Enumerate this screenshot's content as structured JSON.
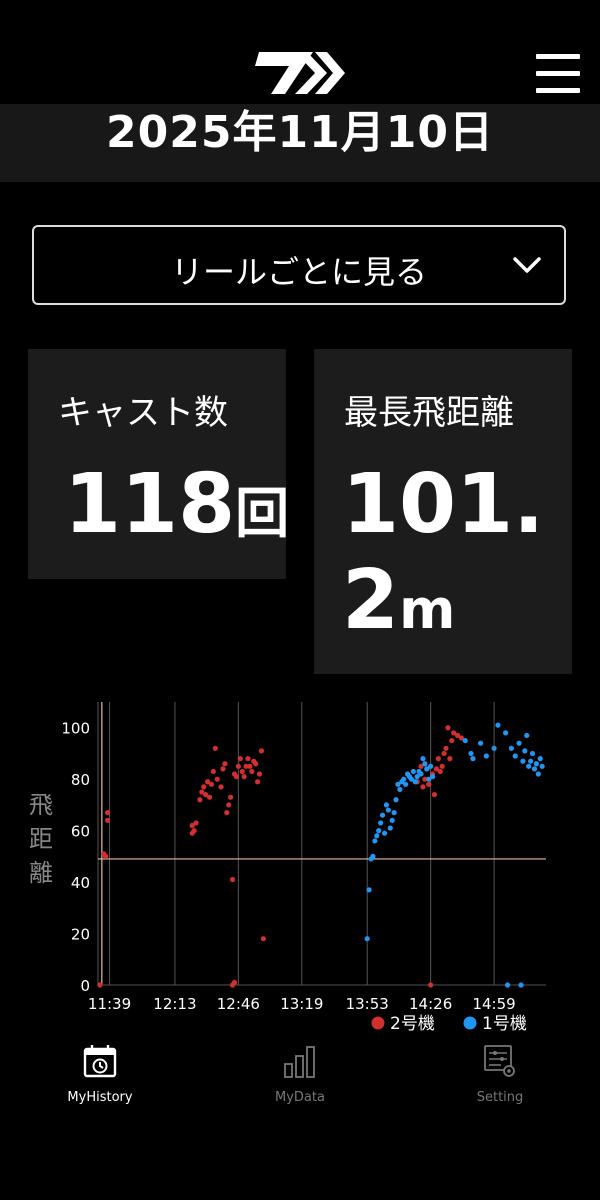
{
  "header": {
    "logo_icon": "daiwa-d-logo-icon",
    "menu_icon": "hamburger-menu-icon",
    "date": "2025年11月10日"
  },
  "view_select": {
    "label": "リールごとに見る",
    "icon": "chevron-down-icon"
  },
  "stats": {
    "cast_count": {
      "title": "キャスト数",
      "value": "118",
      "unit": "回"
    },
    "max_distance": {
      "title": "最長飛距離",
      "value": "101.2",
      "unit": "m"
    }
  },
  "chart_data": {
    "type": "scatter",
    "ylabel": "飛距離",
    "ylim": [
      0,
      110
    ],
    "yticks": [
      0,
      20,
      40,
      60,
      80,
      100
    ],
    "xticks": [
      "11:39",
      "12:13",
      "12:46",
      "13:19",
      "13:53",
      "14:26",
      "14:59"
    ],
    "xlim": [
      "11:33",
      "15:00"
    ],
    "reference_line_y": 49,
    "reference_line_x": "11:35",
    "legend": [
      {
        "name": "2号機",
        "color": "#d32f2f"
      },
      {
        "name": "1号機",
        "color": "#2196f3"
      }
    ],
    "series": [
      {
        "name": "2号機",
        "color": "#d32f2f",
        "points": [
          [
            "11:34",
            0
          ],
          [
            "11:36",
            51
          ],
          [
            "11:37",
            50
          ],
          [
            "11:38",
            64
          ],
          [
            "11:38",
            67
          ],
          [
            "12:22",
            59
          ],
          [
            "12:22",
            62
          ],
          [
            "12:23",
            60
          ],
          [
            "12:24",
            63
          ],
          [
            "12:26",
            72
          ],
          [
            "12:27",
            75
          ],
          [
            "12:28",
            77
          ],
          [
            "12:29",
            74
          ],
          [
            "12:30",
            79
          ],
          [
            "12:31",
            73
          ],
          [
            "12:32",
            78
          ],
          [
            "12:33",
            83
          ],
          [
            "12:34",
            92
          ],
          [
            "12:35",
            80
          ],
          [
            "12:37",
            77
          ],
          [
            "12:38",
            84
          ],
          [
            "12:39",
            86
          ],
          [
            "12:40",
            67
          ],
          [
            "12:41",
            70
          ],
          [
            "12:42",
            73
          ],
          [
            "12:43",
            0
          ],
          [
            "12:43",
            41
          ],
          [
            "12:44",
            1
          ],
          [
            "12:44",
            82
          ],
          [
            "12:45",
            81
          ],
          [
            "12:46",
            85
          ],
          [
            "12:47",
            88
          ],
          [
            "12:48",
            83
          ],
          [
            "12:49",
            81
          ],
          [
            "12:50",
            85
          ],
          [
            "12:51",
            88
          ],
          [
            "12:52",
            85
          ],
          [
            "12:53",
            83
          ],
          [
            "12:54",
            87
          ],
          [
            "12:55",
            86
          ],
          [
            "12:56",
            79
          ],
          [
            "12:57",
            82
          ],
          [
            "12:58",
            91
          ],
          [
            "12:59",
            18
          ],
          [
            "14:19",
            79
          ],
          [
            "14:21",
            85
          ],
          [
            "14:22",
            77
          ],
          [
            "14:23",
            80
          ],
          [
            "14:24",
            84
          ],
          [
            "14:25",
            78
          ],
          [
            "14:26",
            0
          ],
          [
            "14:27",
            82
          ],
          [
            "14:28",
            74
          ],
          [
            "14:29",
            84
          ],
          [
            "14:30",
            88
          ],
          [
            "14:31",
            83
          ],
          [
            "14:32",
            85
          ],
          [
            "14:33",
            90
          ],
          [
            "14:34",
            92
          ],
          [
            "14:35",
            100
          ],
          [
            "14:36",
            88
          ],
          [
            "14:37",
            95
          ],
          [
            "14:38",
            98
          ],
          [
            "14:40",
            97
          ],
          [
            "14:42",
            96
          ]
        ]
      },
      {
        "name": "1号機",
        "color": "#2196f3",
        "points": [
          [
            "13:53",
            18
          ],
          [
            "13:54",
            37
          ],
          [
            "13:55",
            49
          ],
          [
            "13:56",
            50
          ],
          [
            "13:57",
            56
          ],
          [
            "13:58",
            58
          ],
          [
            "13:59",
            60
          ],
          [
            "14:00",
            63
          ],
          [
            "14:01",
            66
          ],
          [
            "14:02",
            59
          ],
          [
            "14:03",
            70
          ],
          [
            "14:04",
            68
          ],
          [
            "14:05",
            61
          ],
          [
            "14:06",
            64
          ],
          [
            "14:07",
            67
          ],
          [
            "14:08",
            72
          ],
          [
            "14:09",
            78
          ],
          [
            "14:10",
            76
          ],
          [
            "14:11",
            79
          ],
          [
            "14:12",
            80
          ],
          [
            "14:13",
            78
          ],
          [
            "14:14",
            82
          ],
          [
            "14:15",
            81
          ],
          [
            "14:16",
            80
          ],
          [
            "14:17",
            83
          ],
          [
            "14:18",
            79
          ],
          [
            "14:19",
            81
          ],
          [
            "14:20",
            83
          ],
          [
            "14:21",
            82
          ],
          [
            "14:22",
            88
          ],
          [
            "14:23",
            86
          ],
          [
            "14:24",
            84
          ],
          [
            "14:25",
            80
          ],
          [
            "14:26",
            85
          ],
          [
            "14:27",
            81
          ],
          [
            "14:44",
            95
          ],
          [
            "14:47",
            90
          ],
          [
            "14:48",
            88
          ],
          [
            "14:52",
            94
          ],
          [
            "14:55",
            89
          ],
          [
            "14:59",
            92
          ],
          [
            "15:01",
            101
          ],
          [
            "15:05",
            98
          ],
          [
            "15:06",
            0
          ],
          [
            "15:08",
            92
          ],
          [
            "15:10",
            89
          ],
          [
            "15:12",
            94
          ],
          [
            "15:13",
            0
          ],
          [
            "15:14",
            87
          ],
          [
            "15:15",
            91
          ],
          [
            "15:16",
            97
          ],
          [
            "15:17",
            85
          ],
          [
            "15:18",
            87
          ],
          [
            "15:19",
            90
          ],
          [
            "15:20",
            84
          ],
          [
            "15:21",
            86
          ],
          [
            "15:22",
            82
          ],
          [
            "15:23",
            88
          ],
          [
            "15:24",
            85
          ]
        ]
      }
    ]
  },
  "tabbar": {
    "tabs": [
      {
        "label": "MyHistory",
        "icon": "calendar-history-icon",
        "active": true
      },
      {
        "label": "MyData",
        "icon": "bar-chart-icon",
        "active": false
      },
      {
        "label": "Setting",
        "icon": "settings-sliders-icon",
        "active": false
      }
    ]
  },
  "colors": {
    "background": "#000000",
    "card": "#1c1c1c",
    "inactive": "#777777",
    "active": "#ffffff"
  }
}
